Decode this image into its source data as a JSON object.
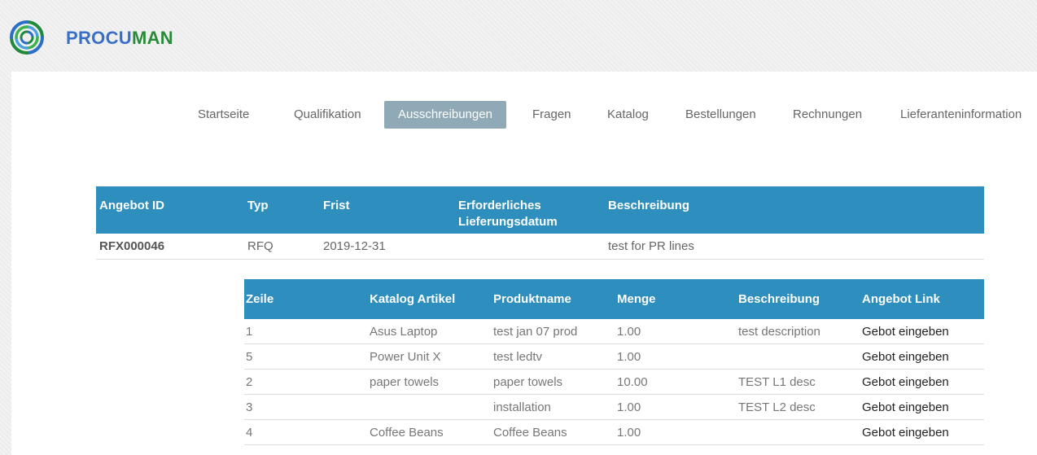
{
  "app": {
    "name_part1": "PROCU",
    "name_part2": "MAN",
    "logo_icon": "spiral-logo-icon"
  },
  "nav": {
    "items": [
      {
        "label": "Startseite",
        "active": false
      },
      {
        "label": "Qualifikation",
        "active": false
      },
      {
        "label": "Ausschreibungen",
        "active": true
      },
      {
        "label": "Fragen",
        "active": false
      },
      {
        "label": "Katalog",
        "active": false
      },
      {
        "label": "Bestellungen",
        "active": false
      },
      {
        "label": "Rechnungen",
        "active": false
      },
      {
        "label": "Lieferanteninformation",
        "active": false
      }
    ]
  },
  "rfx_table": {
    "headers": {
      "id": "Angebot ID",
      "type": "Typ",
      "deadline": "Frist",
      "delivery_line1": "Erforderliches",
      "delivery_line2": "Lieferungsdatum",
      "description": "Beschreibung"
    },
    "rows": [
      {
        "id": "RFX000046",
        "type": "RFQ",
        "deadline": "2019-12-31",
        "delivery": "",
        "description": "test for PR lines"
      }
    ]
  },
  "lines_table": {
    "headers": {
      "line": "Zeile",
      "catalog_item": "Katalog Artikel",
      "product_name": "Produktname",
      "quantity": "Menge",
      "description": "Beschreibung",
      "bid_link": "Angebot Link"
    },
    "rows": [
      {
        "line": "1",
        "catalog_item": "Asus Laptop",
        "product_name": "test jan 07 prod",
        "quantity": "1.00",
        "description": "test description",
        "link": "Gebot eingeben"
      },
      {
        "line": "5",
        "catalog_item": "Power Unit X",
        "product_name": "test ledtv",
        "quantity": "1.00",
        "description": "",
        "link": "Gebot eingeben"
      },
      {
        "line": "2",
        "catalog_item": "paper towels",
        "product_name": "paper towels",
        "quantity": "10.00",
        "description": "TEST L1 desc",
        "link": "Gebot eingeben"
      },
      {
        "line": "3",
        "catalog_item": "",
        "product_name": "installation",
        "quantity": "1.00",
        "description": "TEST L2 desc",
        "link": "Gebot eingeben"
      },
      {
        "line": "4",
        "catalog_item": "Coffee Beans",
        "product_name": "Coffee Beans",
        "quantity": "1.00",
        "description": "",
        "link": "Gebot eingeben"
      }
    ]
  },
  "colors": {
    "header_blue": "#2e8fbf",
    "nav_active": "#8fa9b6",
    "brand_blue": "#3a6fc9",
    "brand_green": "#2a8a3a"
  }
}
